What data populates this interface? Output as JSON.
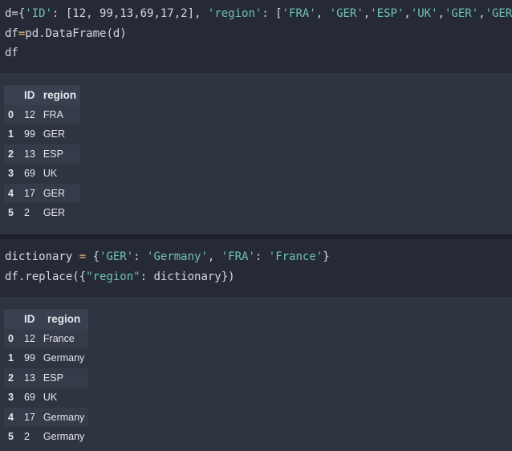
{
  "cell1": {
    "code": {
      "line1": {
        "a": "d={",
        "b": "'ID'",
        "c": ": [12, 99,13,69,17,2], ",
        "d": "'region'",
        "e": ": [",
        "f": "'FRA'",
        "g": ", ",
        "h": "'GER'",
        "i": ",",
        "j": "'ESP'",
        "k": ",",
        "l": "'UK'",
        "m": ",",
        "n": "'GER'",
        "o": ",",
        "p": "'GER'",
        "q": "]}"
      },
      "line2": {
        "a": "df",
        "b": "=",
        "c": "pd.DataFrame(d)"
      },
      "line3": "df"
    },
    "output": {
      "columns": [
        "",
        "ID",
        "region"
      ],
      "rows": [
        {
          "index": "0",
          "id": "12",
          "region": "FRA"
        },
        {
          "index": "1",
          "id": "99",
          "region": "GER"
        },
        {
          "index": "2",
          "id": "13",
          "region": "ESP"
        },
        {
          "index": "3",
          "id": "69",
          "region": "UK"
        },
        {
          "index": "4",
          "id": "17",
          "region": "GER"
        },
        {
          "index": "5",
          "id": "2",
          "region": "GER"
        }
      ]
    }
  },
  "cell2": {
    "code": {
      "line1": {
        "a": "dictionary ",
        "b": "=",
        "c": " {",
        "d": "'GER'",
        "e": ": ",
        "f": "'Germany'",
        "g": ", ",
        "h": "'FRA'",
        "i": ": ",
        "j": "'France'",
        "k": "}"
      },
      "line2": {
        "a": "df.replace({",
        "b": "\"region\"",
        "c": ": dictionary})"
      }
    },
    "output": {
      "columns": [
        "",
        "ID",
        "region"
      ],
      "rows": [
        {
          "index": "0",
          "id": "12",
          "region": "France"
        },
        {
          "index": "1",
          "id": "99",
          "region": "Germany"
        },
        {
          "index": "2",
          "id": "13",
          "region": "ESP"
        },
        {
          "index": "3",
          "id": "69",
          "region": "UK"
        },
        {
          "index": "4",
          "id": "17",
          "region": "Germany"
        },
        {
          "index": "5",
          "id": "2",
          "region": "Germany"
        }
      ]
    }
  },
  "colors": {
    "code_bg": "#262a36",
    "output_bg": "#2f3441",
    "string": "#6fc3b4",
    "operator": "#e5c07b",
    "text": "#d4d7de"
  }
}
